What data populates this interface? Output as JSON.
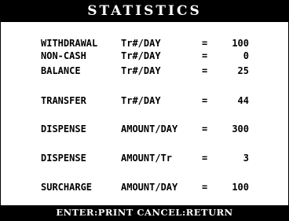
{
  "title": "STATISTICS",
  "rows": [
    {
      "label": "WITHDRAWAL",
      "unit": "Tr#/DAY",
      "eq": "=",
      "value": "100"
    },
    {
      "label": "NON-CASH",
      "unit": "Tr#/DAY",
      "eq": "=",
      "value": "0"
    },
    {
      "label": "BALANCE",
      "unit": "Tr#/DAY",
      "eq": "=",
      "value": "25"
    },
    {
      "label": "TRANSFER",
      "unit": "Tr#/DAY",
      "eq": "=",
      "value": "44"
    },
    {
      "label": "DISPENSE",
      "unit": "AMOUNT/DAY",
      "eq": "=",
      "value": "300"
    },
    {
      "label": "DISPENSE",
      "unit": "AMOUNT/Tr",
      "eq": "=",
      "value": "3"
    },
    {
      "label": "SURCHARGE",
      "unit": "AMOUNT/DAY",
      "eq": "=",
      "value": "100"
    }
  ],
  "footer": "ENTER:PRINT CANCEL:RETURN"
}
